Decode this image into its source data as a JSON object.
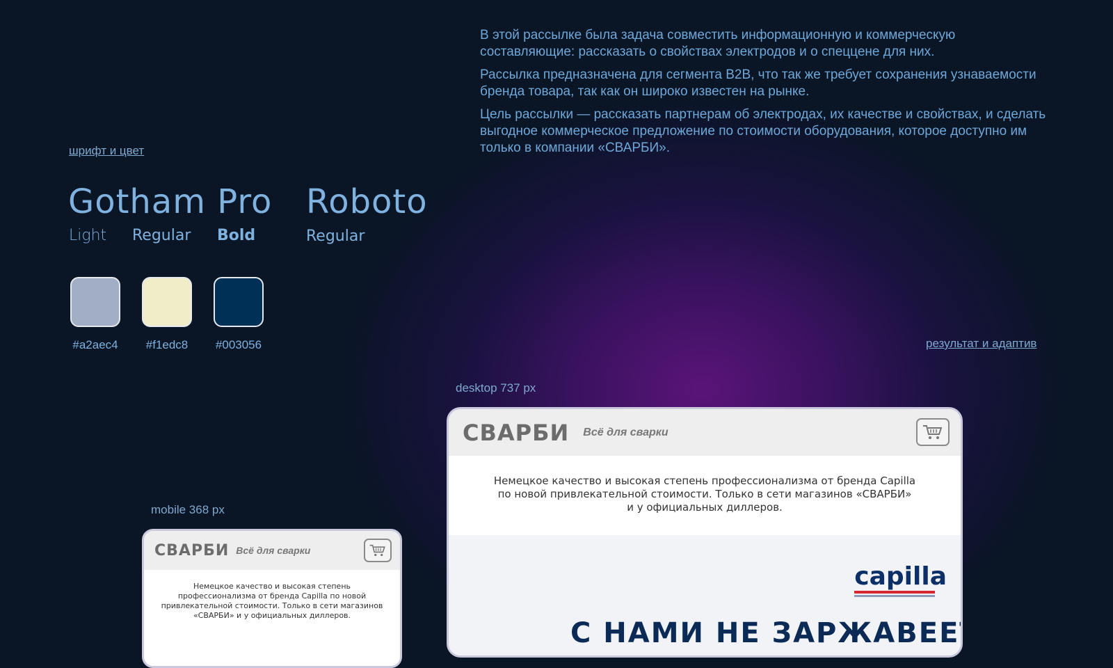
{
  "intro": {
    "p1": "В этой рассылке была задача совместить информационную и коммерческую составляющие: рассказать о свойствах электродов  и о спеццене для них.",
    "p2": "Рассылка предназначена для сегмента B2B, что так же требует сохранения узнаваемости бренда товара, так как он широко известен на рынке.",
    "p3": "Цель рассылки — рассказать партнерам об электродах, их качестве и свойствах, и сделать выгодное коммерческое предложение по стоимости оборудования, которое доступно им только в компании «СВАРБИ»."
  },
  "links": {
    "font_color": "шрифт и цвет",
    "result": "результат и адаптив"
  },
  "fonts": {
    "gotham": {
      "name": "Gotham Pro",
      "weights": [
        "Light",
        "Regular",
        "Bold"
      ]
    },
    "roboto": {
      "name": "Roboto",
      "weights": [
        "Regular"
      ]
    }
  },
  "swatches": [
    {
      "color": "#a2aec4",
      "label": "#a2aec4"
    },
    {
      "color": "#f1edc8",
      "label": "#f1edc8"
    },
    {
      "color": "#003056",
      "label": "#003056"
    }
  ],
  "previews": {
    "desktop_label": "desktop 737 px",
    "mobile_label": "mobile 368 px"
  },
  "email": {
    "logo": "СВАРБИ",
    "tagline": "Всё для сварки",
    "body_desktop": [
      "Немецкое качество и высокая степень профессионализма от бренда Capilla",
      "по новой привлекательной стоимости. Только в сети магазинов «СВАРБИ»",
      "и у официальных диллеров."
    ],
    "body_mobile": [
      "Немецкое качество и высокая степень",
      "профессионализма от бренда Capilla по новой",
      "привлекательной стоимости. Только в сети магазинов",
      "«СВАРБИ» и у официальных диллеров."
    ],
    "brand": "capilla",
    "headline": "С НАМИ НЕ ЗАРЖАВЕЕТ"
  },
  "colors": {
    "accent": "#7fb2df",
    "navy": "#003056",
    "capilla_red": "#d6262e"
  }
}
